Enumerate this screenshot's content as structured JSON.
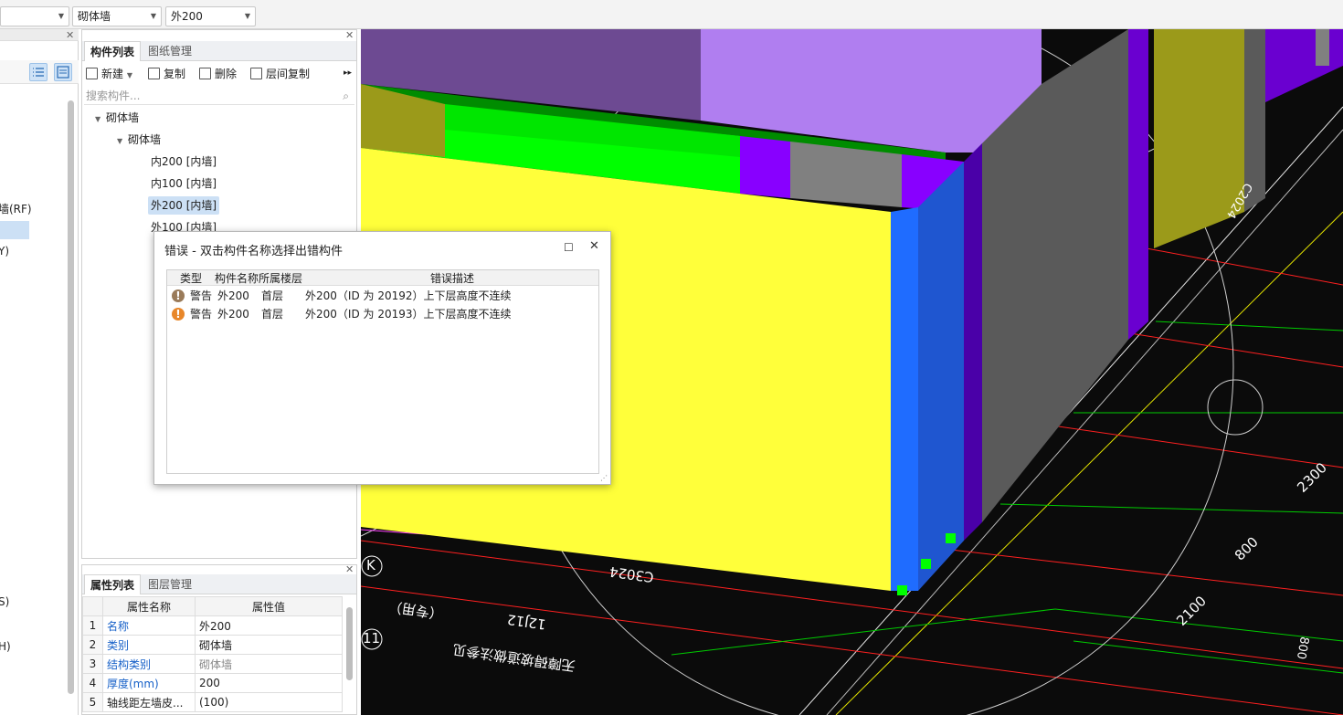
{
  "toolbar": {
    "combo1_value": "",
    "combo2_value": "砌体墙",
    "combo3_value": "外200"
  },
  "left_panel": {
    "items": [
      "墙(RF)",
      "\")",
      "Y)",
      "S)",
      "H)"
    ]
  },
  "component_panel": {
    "tabs": [
      "构件列表",
      "图纸管理"
    ],
    "toolbar": {
      "new": "新建",
      "copy": "复制",
      "delete": "删除",
      "floor_copy": "层间复制",
      "more": "▸▸"
    },
    "search_placeholder": "搜索构件...",
    "tree": {
      "root": "砌体墙",
      "group": "砌体墙",
      "items": [
        "内200 [内墙]",
        "内100 [内墙]",
        "外200 [内墙]",
        "外100 [内墙]"
      ],
      "selected_index": 2
    }
  },
  "property_panel": {
    "tabs": [
      "属性列表",
      "图层管理"
    ],
    "columns": [
      "属性名称",
      "属性值"
    ],
    "rows": [
      {
        "num": "1",
        "name": "名称",
        "value": "外200"
      },
      {
        "num": "2",
        "name": "类别",
        "value": "砌体墙"
      },
      {
        "num": "3",
        "name": "结构类别",
        "value": "砌体墙"
      },
      {
        "num": "4",
        "name": "厚度(mm)",
        "value": "200"
      },
      {
        "num": "5",
        "name": "轴线距左墙皮...",
        "value": "(100)"
      }
    ]
  },
  "dialog": {
    "title": "错误 - 双击构件名称选择出错构件",
    "columns": {
      "type": "类型",
      "name": "构件名称",
      "floor": "所属楼层",
      "desc": "错误描述"
    },
    "rows": [
      {
        "type": "警告",
        "name": "外200",
        "floor": "首层",
        "desc": "外200（ID 为 20192）上下层高度不连续",
        "icon_color": "#9a7b5a"
      },
      {
        "type": "警告",
        "name": "外200",
        "floor": "首层",
        "desc": "外200（ID 为 20193）上下层高度不连续",
        "icon_color": "#e8872a"
      }
    ]
  },
  "viewport": {
    "axis_labels": [
      "K",
      "11"
    ],
    "dimensions": [
      "2300",
      "800",
      "2100",
      "C3024"
    ],
    "rotated_texts": [
      "12J12",
      "无障碍坡道做法参见",
      "（专用）",
      "C2024",
      "800"
    ],
    "colors": {
      "wall_yellow": "#ffff3a",
      "wall_green": "#00ff00",
      "wall_purple": "#b07ef0",
      "wall_violet": "#7a00e8",
      "wall_gray": "#5a5a5a",
      "wall_blue": "#1f6cff",
      "wall_olive": "#9b9a1a"
    }
  }
}
